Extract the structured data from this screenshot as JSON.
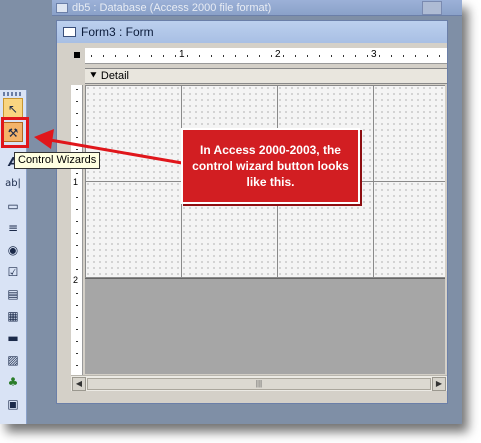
{
  "db_window": {
    "title": "db5 : Database (Access 2000 file format)"
  },
  "form_window": {
    "title": "Form3 : Form",
    "section": "Detail",
    "ruler_marks": [
      "1",
      "2",
      "3"
    ],
    "v_ruler_marks": [
      "1",
      "2"
    ],
    "scrollbar_grip": "|||"
  },
  "toolbox": {
    "tools": [
      {
        "icon": "select-objects-icon",
        "glyph": "↖"
      },
      {
        "icon": "control-wizards-icon",
        "glyph": "⚒"
      },
      {
        "icon": "label-icon",
        "glyph": "A"
      },
      {
        "icon": "textbox-icon",
        "glyph": "ab|"
      },
      {
        "icon": "option-group-icon",
        "glyph": "▭"
      },
      {
        "icon": "toggle-button-icon",
        "glyph": "≡"
      },
      {
        "icon": "option-button-icon",
        "glyph": "◉"
      },
      {
        "icon": "check-box-icon",
        "glyph": "☑"
      },
      {
        "icon": "combo-box-icon",
        "glyph": "▤"
      },
      {
        "icon": "list-box-icon",
        "glyph": "▦"
      },
      {
        "icon": "command-button-icon",
        "glyph": "▬"
      },
      {
        "icon": "image-icon",
        "glyph": "▨"
      },
      {
        "icon": "unbound-object-frame-icon",
        "glyph": "♣"
      },
      {
        "icon": "bound-object-frame-icon",
        "glyph": "▣"
      }
    ]
  },
  "tooltip": {
    "text": "Control Wizards"
  },
  "callout": {
    "text": "In Access 2000-2003, the control wizard button looks like this."
  },
  "colors": {
    "callout_red": "#d21e22",
    "highlight_red": "#e0161b",
    "tooltip_bg": "#ffffe1"
  }
}
